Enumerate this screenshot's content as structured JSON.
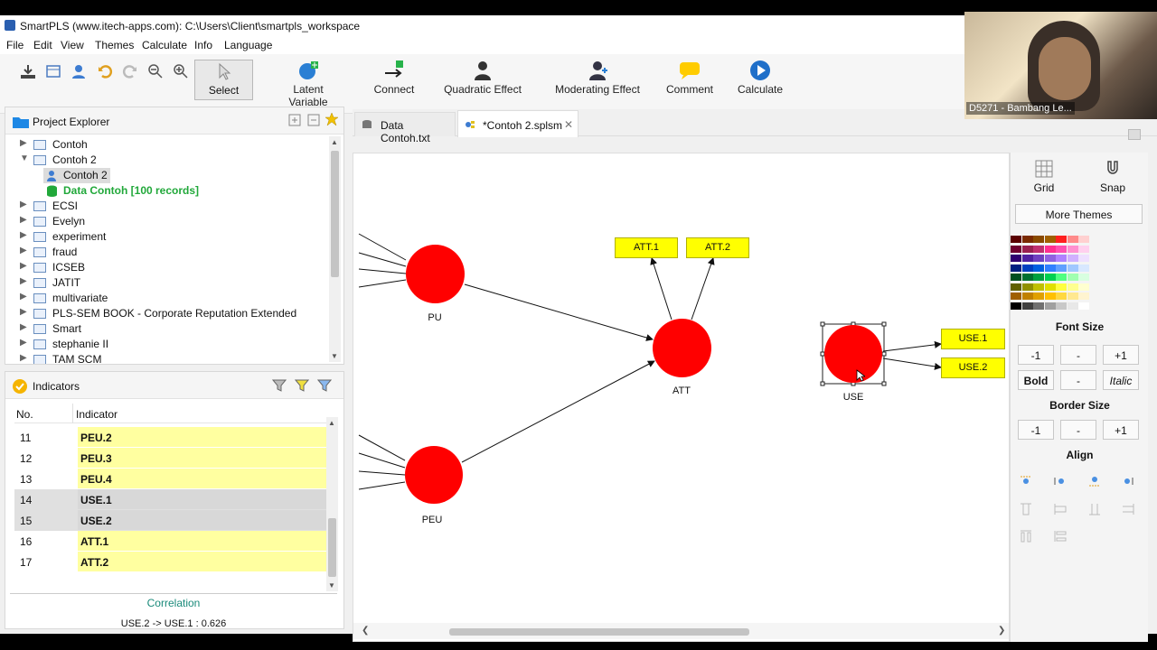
{
  "window": {
    "title": "SmartPLS (www.itech-apps.com): C:\\Users\\Client\\smartpls_workspace"
  },
  "menu": [
    "File",
    "Edit",
    "View",
    "Themes",
    "Calculate",
    "Info",
    "Language"
  ],
  "toolbar": {
    "select": "Select",
    "latent_variable": "Latent Variable",
    "connect": "Connect",
    "quadratic_effect": "Quadratic Effect",
    "moderating_effect": "Moderating Effect",
    "comment": "Comment",
    "calculate": "Calculate"
  },
  "project_explorer": {
    "title": "Project Explorer",
    "items": [
      {
        "label": "Contoh",
        "expanded": false
      },
      {
        "label": "Contoh 2",
        "expanded": true
      },
      {
        "label": "Contoh 2",
        "child": "model"
      },
      {
        "label": "Data Contoh [100 records]",
        "child": "data"
      },
      {
        "label": "ECSI",
        "expanded": false
      },
      {
        "label": "Evelyn",
        "expanded": false
      },
      {
        "label": "experiment",
        "expanded": false
      },
      {
        "label": "fraud",
        "expanded": false
      },
      {
        "label": "ICSEB",
        "expanded": false
      },
      {
        "label": "JATIT",
        "expanded": false
      },
      {
        "label": "multivariate",
        "expanded": false
      },
      {
        "label": "PLS-SEM BOOK - Corporate Reputation Extended",
        "expanded": false
      },
      {
        "label": "Smart",
        "expanded": false
      },
      {
        "label": "stephanie II",
        "expanded": false
      },
      {
        "label": "TAM SCM",
        "expanded": false
      }
    ]
  },
  "indicators": {
    "title": "Indicators",
    "col_no": "No.",
    "col_indicator": "Indicator",
    "rows": [
      {
        "no": "11",
        "name": "PEU.2",
        "state": "yellow"
      },
      {
        "no": "12",
        "name": "PEU.3",
        "state": "yellow"
      },
      {
        "no": "13",
        "name": "PEU.4",
        "state": "yellow"
      },
      {
        "no": "14",
        "name": "USE.1",
        "state": "selected"
      },
      {
        "no": "15",
        "name": "USE.2",
        "state": "selected"
      },
      {
        "no": "16",
        "name": "ATT.1",
        "state": "yellow"
      },
      {
        "no": "17",
        "name": "ATT.2",
        "state": "yellow"
      }
    ],
    "correlation_title": "Correlation",
    "correlation_text": "USE.2 -> USE.1 : 0.626"
  },
  "tabs": [
    {
      "label": "Data Contoh.txt",
      "active": false
    },
    {
      "label": "*Contoh 2.splsm",
      "active": true
    }
  ],
  "model": {
    "latent": {
      "PU": "PU",
      "PEU": "PEU",
      "ATT": "ATT",
      "USE": "USE"
    },
    "indicators": {
      "att1": "ATT.1",
      "att2": "ATT.2",
      "use1": "USE.1",
      "use2": "USE.2"
    }
  },
  "right_panel": {
    "grid": "Grid",
    "snap": "Snap",
    "more_themes": "More Themes",
    "font_size": "Font Size",
    "minus1": "-1",
    "dash": "-",
    "plus1": "+1",
    "bold": "Bold",
    "italic": "Italic",
    "border_size": "Border Size",
    "align": "Align"
  },
  "webcam": {
    "label": "D5271 - Bambang Le..."
  },
  "colors": {
    "node_fill": "#ff0000",
    "indicator_fill": "#ffff00",
    "accent": "#2a7fd4"
  }
}
